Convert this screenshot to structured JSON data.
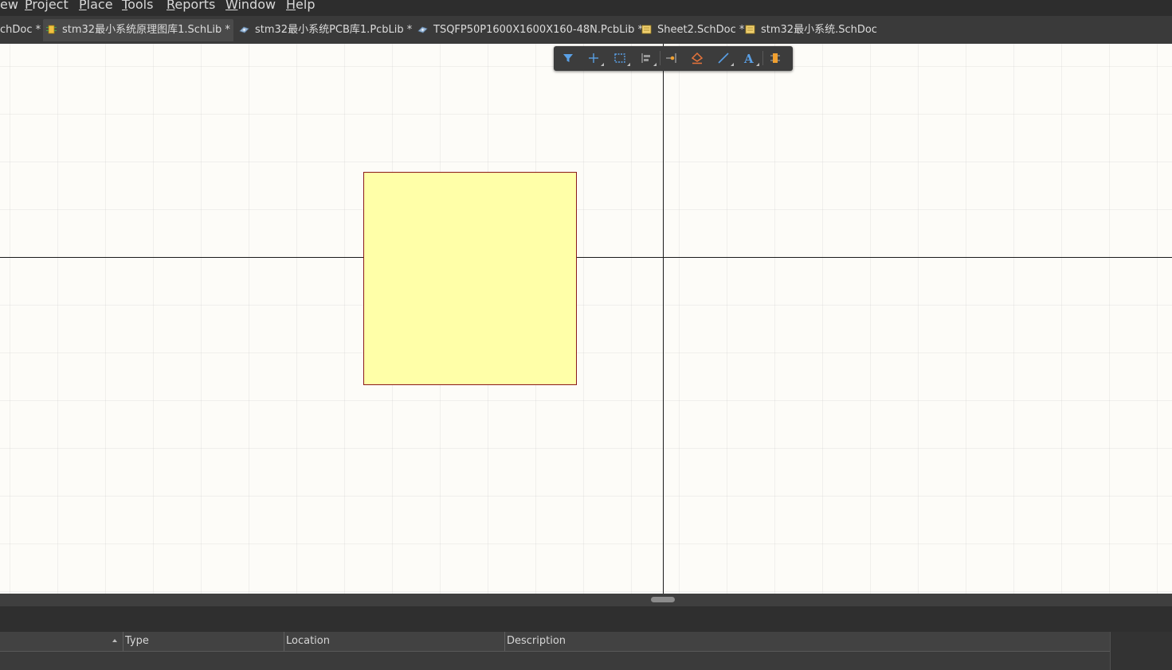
{
  "menubar": {
    "items": [
      {
        "label": "ew",
        "accel": ""
      },
      {
        "label": "roject",
        "accel": "P"
      },
      {
        "label": "lace",
        "accel": "P"
      },
      {
        "label": "ools",
        "accel": "T"
      },
      {
        "label": "eports",
        "accel": "R"
      },
      {
        "label": "indow",
        "accel": "W"
      },
      {
        "label": "elp",
        "accel": "H"
      }
    ]
  },
  "tabs": [
    {
      "label": "chDoc *",
      "icon": "none",
      "active": false
    },
    {
      "label": "stm32最小系统原理图库1.SchLib *",
      "icon": "schlib-icon",
      "active": true
    },
    {
      "label": "stm32最小系统PCB库1.PcbLib *",
      "icon": "pcblib-icon",
      "active": false
    },
    {
      "label": "TSQFP50P1600X1600X160-48N.PcbLib *",
      "icon": "pcblib-icon",
      "active": false
    },
    {
      "label": "Sheet2.SchDoc *",
      "icon": "schdoc-icon",
      "active": false
    },
    {
      "label": "stm32最小系统.SchDoc",
      "icon": "schdoc-icon",
      "active": false
    }
  ],
  "toolbar": {
    "buttons": [
      {
        "name": "filter-icon",
        "color": "#5aa0e6"
      },
      {
        "name": "crosshair-icon",
        "color": "#5aa0e6"
      },
      {
        "name": "selection-rect-icon",
        "color": "#5aa0e6"
      },
      {
        "name": "align-icon",
        "color": "#9a9a9a"
      },
      {
        "name": "place-pin-icon",
        "color": "#f0a030"
      },
      {
        "name": "ieee-symbol-icon",
        "color": "#e8743a"
      },
      {
        "name": "line-icon",
        "color": "#5aa0e6"
      },
      {
        "name": "text-icon",
        "color": "#5aa0e6"
      },
      {
        "name": "part-icon",
        "color": "#f0a030"
      }
    ]
  },
  "canvas": {
    "background": "#fdfcf8",
    "component_fill": "#ffffa8",
    "component_border": "#8b1a1a"
  },
  "panel": {
    "columns": [
      {
        "label": "Type"
      },
      {
        "label": "Location"
      },
      {
        "label": "Description"
      }
    ]
  }
}
